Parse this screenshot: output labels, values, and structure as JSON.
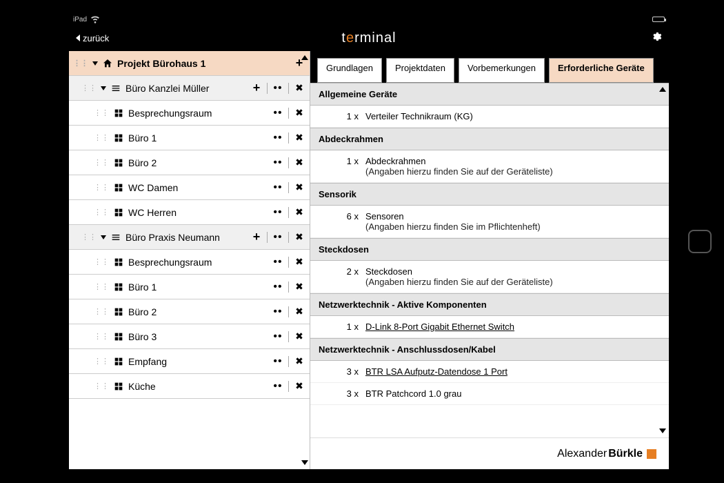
{
  "status": {
    "device": "iPad"
  },
  "header": {
    "back": "zurück",
    "title_pre": "t",
    "title_e": "e",
    "title_post": "rminal"
  },
  "tree": {
    "project": "Projekt Bürohaus 1",
    "folders": [
      {
        "label": "Büro Kanzlei Müller",
        "rooms": [
          "Besprechungsraum",
          "Büro 1",
          "Büro 2",
          "WC Damen",
          "WC Herren"
        ]
      },
      {
        "label": "Büro Praxis Neumann",
        "rooms": [
          "Besprechungsraum",
          "Büro 1",
          "Büro 2",
          "Büro 3",
          "Empfang",
          "Küche"
        ]
      }
    ]
  },
  "tabs": [
    "Grundlagen",
    "Projektdaten",
    "Vorbemerkungen",
    "Erforderliche Geräte"
  ],
  "active_tab": 3,
  "devices": [
    {
      "section": "Allgemeine Geräte"
    },
    {
      "qty": "1 x",
      "text": "Verteiler Technikraum (KG)"
    },
    {
      "section": "Abdeckrahmen"
    },
    {
      "qty": "1 x",
      "text": "Abdeckrahmen",
      "sub": "(Angaben hierzu finden Sie auf der Geräteliste)"
    },
    {
      "section": "Sensorik"
    },
    {
      "qty": "6 x",
      "text": "Sensoren",
      "sub": "(Angaben hierzu finden Sie im Pflichtenheft)"
    },
    {
      "section": "Steckdosen"
    },
    {
      "qty": "2 x",
      "text": "Steckdosen",
      "sub": "(Angaben hierzu finden Sie auf der Geräteliste)"
    },
    {
      "section": "Netzwerktechnik - Aktive Komponenten"
    },
    {
      "qty": "1 x",
      "link": "D-Link 8-Port Gigabit Ethernet Switch"
    },
    {
      "section": "Netzwerktechnik - Anschlussdosen/Kabel"
    },
    {
      "qty": "3 x",
      "link": "BTR LSA Aufputz-Datendose 1 Port"
    },
    {
      "qty": "3 x",
      "text": "BTR Patchcord 1.0 grau"
    }
  ],
  "brand": {
    "a": "Alexander",
    "b": "Bürkle"
  }
}
